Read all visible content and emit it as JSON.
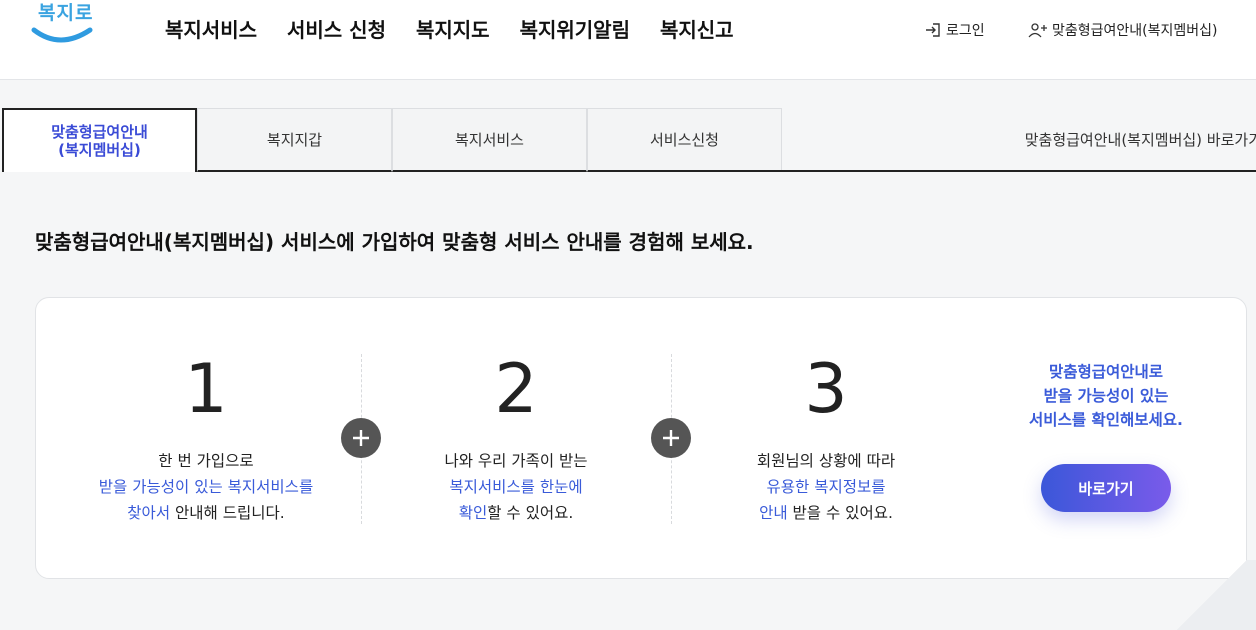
{
  "header": {
    "logo_text": "복지로",
    "nav": [
      "복지서비스",
      "서비스 신청",
      "복지지도",
      "복지위기알림",
      "복지신고"
    ],
    "login_label": "로그인",
    "member_label": "맞춤형급여안내(복지멤버십)"
  },
  "tabs": {
    "items": [
      {
        "line1": "맞춤형급여안내",
        "line2": "(복지멤버십)"
      },
      {
        "label": "복지지갑"
      },
      {
        "label": "복지서비스"
      },
      {
        "label": "서비스신청"
      }
    ],
    "shortcut_label": "맞춤형급여안내(복지멤버십) 바로가기"
  },
  "main": {
    "headline": "맞춤형급여안내(복지멤버십) 서비스에 가입하여 맞춤형 서비스 안내를 경험해 보세요.",
    "steps": [
      {
        "num": "1",
        "line1": "한 번 가입으로",
        "line2_hl": "받을 가능성이 있는 복지서비스를",
        "line3_hl": "찾아서",
        "line3_rest": " 안내해 드립니다."
      },
      {
        "num": "2",
        "line1": "나와 우리 가족이 받는",
        "line2_hl": "복지서비스를 한눈에",
        "line3_hl": "확인",
        "line3_rest": "할 수 있어요."
      },
      {
        "num": "3",
        "line1": "회원님의 상황에 따라",
        "line2_hl": "유용한 복지정보를",
        "line3_hl": "안내",
        "line3_rest": " 받을 수 있어요."
      }
    ],
    "side_lines": [
      "맞춤형급여안내로",
      "받을 가능성이 있는",
      "서비스를 확인해보세요."
    ],
    "go_button": "바로가기"
  },
  "colors": {
    "accent": "#3a5bd9",
    "button_start": "#3b57d9",
    "button_end": "#7a5bea"
  }
}
